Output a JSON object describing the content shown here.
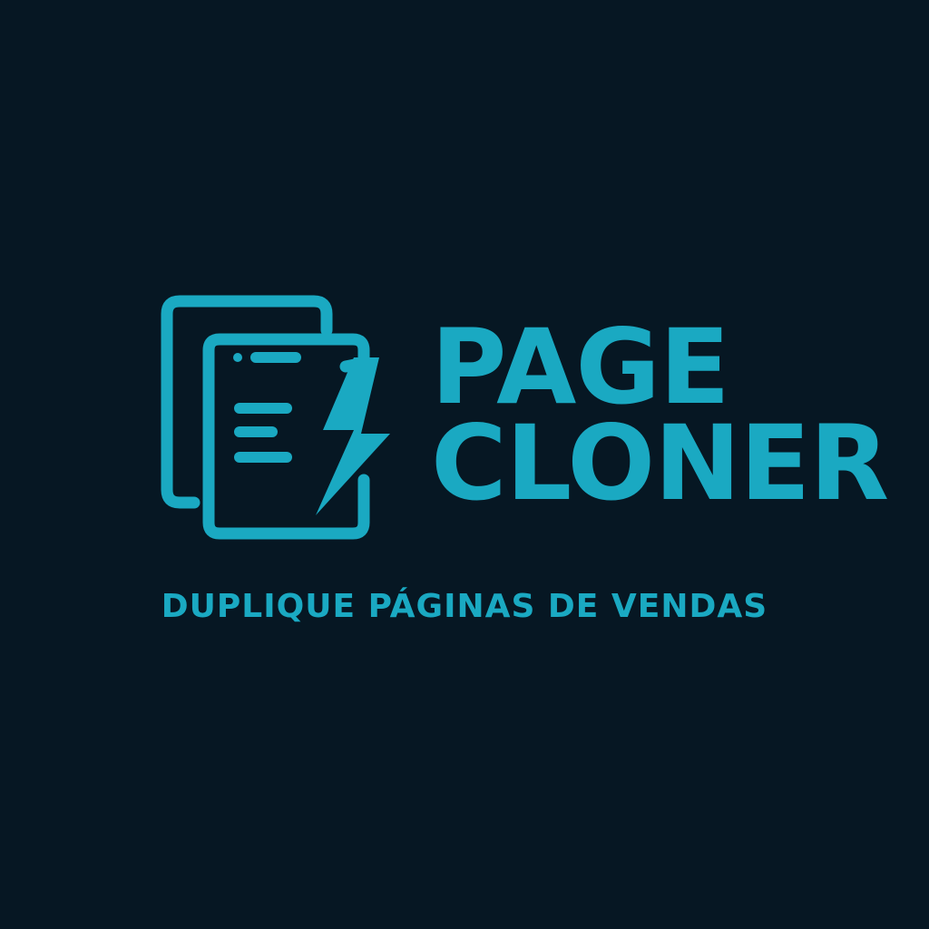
{
  "logo": {
    "icon": "cloned-page-lightning-icon",
    "word_line_1": "PAGE",
    "word_line_2": "CLONER",
    "tagline": "DUPLIQUE PÁGINAS DE VENDAS"
  },
  "colors": {
    "background": "#061723",
    "accent": "#1aa9c2"
  }
}
